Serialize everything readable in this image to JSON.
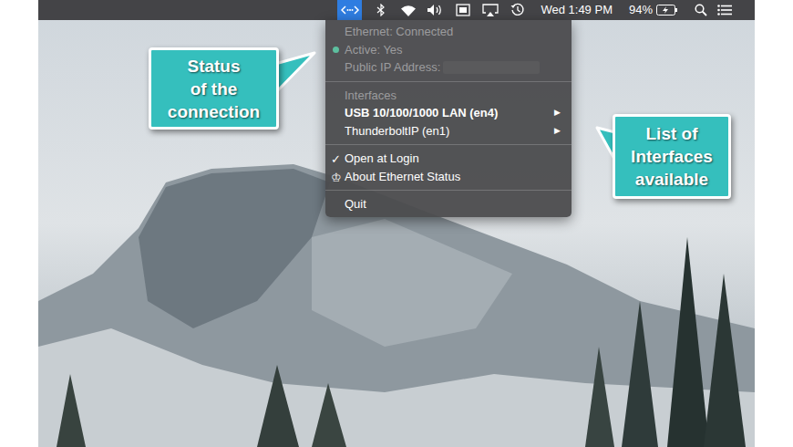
{
  "menu_bar": {
    "status_item": {
      "selected": true
    },
    "clock": "Wed 1:49 PM",
    "battery": "94%"
  },
  "menu": {
    "items": [
      {
        "kind": "text",
        "label": "Ethernet: Connected",
        "disabled": true
      },
      {
        "kind": "status",
        "label": "Active: Yes",
        "disabled": true,
        "color": "#5dbf9f"
      },
      {
        "kind": "field",
        "label": "Public IP Address:",
        "disabled": true
      },
      {
        "kind": "separator"
      },
      {
        "kind": "text",
        "label": "Interfaces",
        "disabled": true
      },
      {
        "kind": "submenu",
        "label": "USB 10/100/1000 LAN (en4)",
        "bold": true,
        "arrow": "▶",
        "disabled": false
      },
      {
        "kind": "submenu",
        "label": "ThunderboltIP (en1)",
        "bold": false,
        "arrow": "▶",
        "disabled": false
      },
      {
        "kind": "separator"
      },
      {
        "kind": "check",
        "label": "Open at Login",
        "mark": "✓",
        "checked": true,
        "disabled": false
      },
      {
        "kind": "icon",
        "label": "About Ethernet Status",
        "mark": "♔",
        "disabled": false
      },
      {
        "kind": "separator"
      },
      {
        "kind": "text",
        "label": "Quit",
        "disabled": false
      }
    ]
  },
  "callouts": [
    {
      "lines": [
        "Status",
        "of the",
        "connection"
      ]
    },
    {
      "lines": [
        "List of",
        "Interfaces",
        "available"
      ]
    }
  ]
}
